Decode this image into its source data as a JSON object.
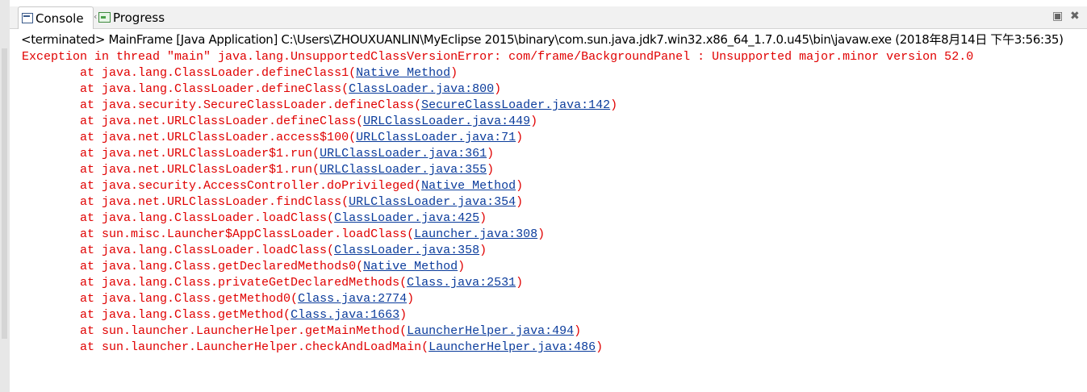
{
  "tabs": [
    {
      "label": "Console",
      "icon": "console-icon"
    },
    {
      "label": "Progress",
      "icon": "progress-icon"
    }
  ],
  "tab_overflow": "‹",
  "window_controls": {
    "minimize": "▣",
    "maximize": "✖"
  },
  "status": "<terminated> MainFrame [Java Application] C:\\Users\\ZHOUXUANLIN\\MyEclipse 2015\\binary\\com.sun.java.jdk7.win32.x86_64_1.7.0.u45\\bin\\javaw.exe (2018年8月14日 下午3:56:35)",
  "colors": {
    "error_text": "#e00000",
    "link": "#0b3c9c"
  },
  "exception": "Exception in thread \"main\" java.lang.UnsupportedClassVersionError: com/frame/BackgroundPanel : Unsupported major.minor version 52.0",
  "stack": [
    {
      "prefix": "\tat java.lang.ClassLoader.defineClass1(",
      "link": "Native Method",
      "suffix": ")"
    },
    {
      "prefix": "\tat java.lang.ClassLoader.defineClass(",
      "link": "ClassLoader.java:800",
      "suffix": ")"
    },
    {
      "prefix": "\tat java.security.SecureClassLoader.defineClass(",
      "link": "SecureClassLoader.java:142",
      "suffix": ")"
    },
    {
      "prefix": "\tat java.net.URLClassLoader.defineClass(",
      "link": "URLClassLoader.java:449",
      "suffix": ")"
    },
    {
      "prefix": "\tat java.net.URLClassLoader.access$100(",
      "link": "URLClassLoader.java:71",
      "suffix": ")"
    },
    {
      "prefix": "\tat java.net.URLClassLoader$1.run(",
      "link": "URLClassLoader.java:361",
      "suffix": ")"
    },
    {
      "prefix": "\tat java.net.URLClassLoader$1.run(",
      "link": "URLClassLoader.java:355",
      "suffix": ")"
    },
    {
      "prefix": "\tat java.security.AccessController.doPrivileged(",
      "link": "Native Method",
      "suffix": ")"
    },
    {
      "prefix": "\tat java.net.URLClassLoader.findClass(",
      "link": "URLClassLoader.java:354",
      "suffix": ")"
    },
    {
      "prefix": "\tat java.lang.ClassLoader.loadClass(",
      "link": "ClassLoader.java:425",
      "suffix": ")"
    },
    {
      "prefix": "\tat sun.misc.Launcher$AppClassLoader.loadClass(",
      "link": "Launcher.java:308",
      "suffix": ")"
    },
    {
      "prefix": "\tat java.lang.ClassLoader.loadClass(",
      "link": "ClassLoader.java:358",
      "suffix": ")"
    },
    {
      "prefix": "\tat java.lang.Class.getDeclaredMethods0(",
      "link": "Native Method",
      "suffix": ")"
    },
    {
      "prefix": "\tat java.lang.Class.privateGetDeclaredMethods(",
      "link": "Class.java:2531",
      "suffix": ")"
    },
    {
      "prefix": "\tat java.lang.Class.getMethod0(",
      "link": "Class.java:2774",
      "suffix": ")"
    },
    {
      "prefix": "\tat java.lang.Class.getMethod(",
      "link": "Class.java:1663",
      "suffix": ")"
    },
    {
      "prefix": "\tat sun.launcher.LauncherHelper.getMainMethod(",
      "link": "LauncherHelper.java:494",
      "suffix": ")"
    },
    {
      "prefix": "\tat sun.launcher.LauncherHelper.checkAndLoadMain(",
      "link": "LauncherHelper.java:486",
      "suffix": ")"
    }
  ]
}
